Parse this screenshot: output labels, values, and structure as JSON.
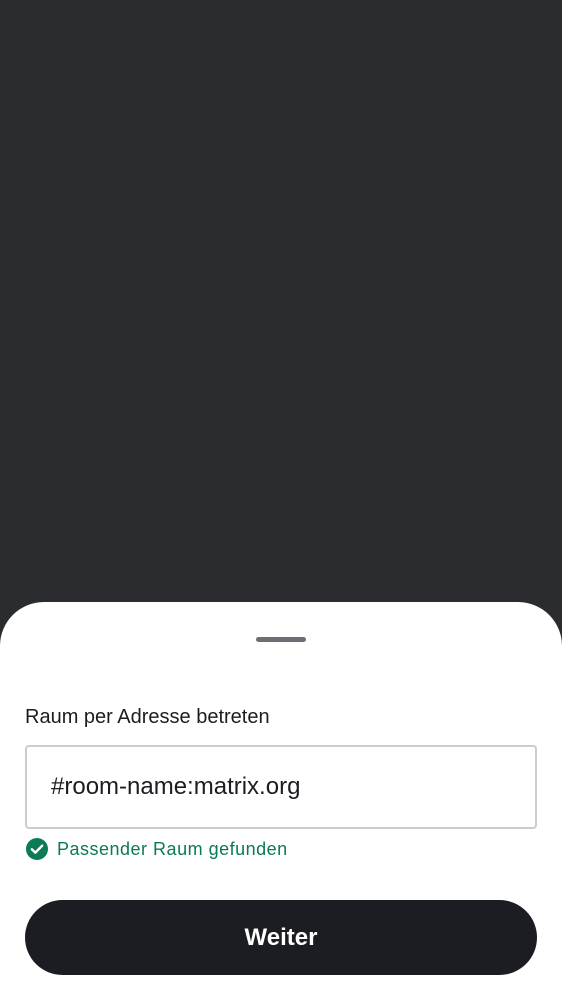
{
  "dialog": {
    "label": "Raum per Adresse betreten",
    "input_value": "#room-name:matrix.org",
    "status_text": "Passender Raum gefunden",
    "status_icon": "check-circle-icon",
    "continue_label": "Weiter"
  },
  "colors": {
    "backdrop": "#2b2c2f",
    "sheet": "#ffffff",
    "success": "#0b7a56",
    "button": "#1b1d22"
  }
}
